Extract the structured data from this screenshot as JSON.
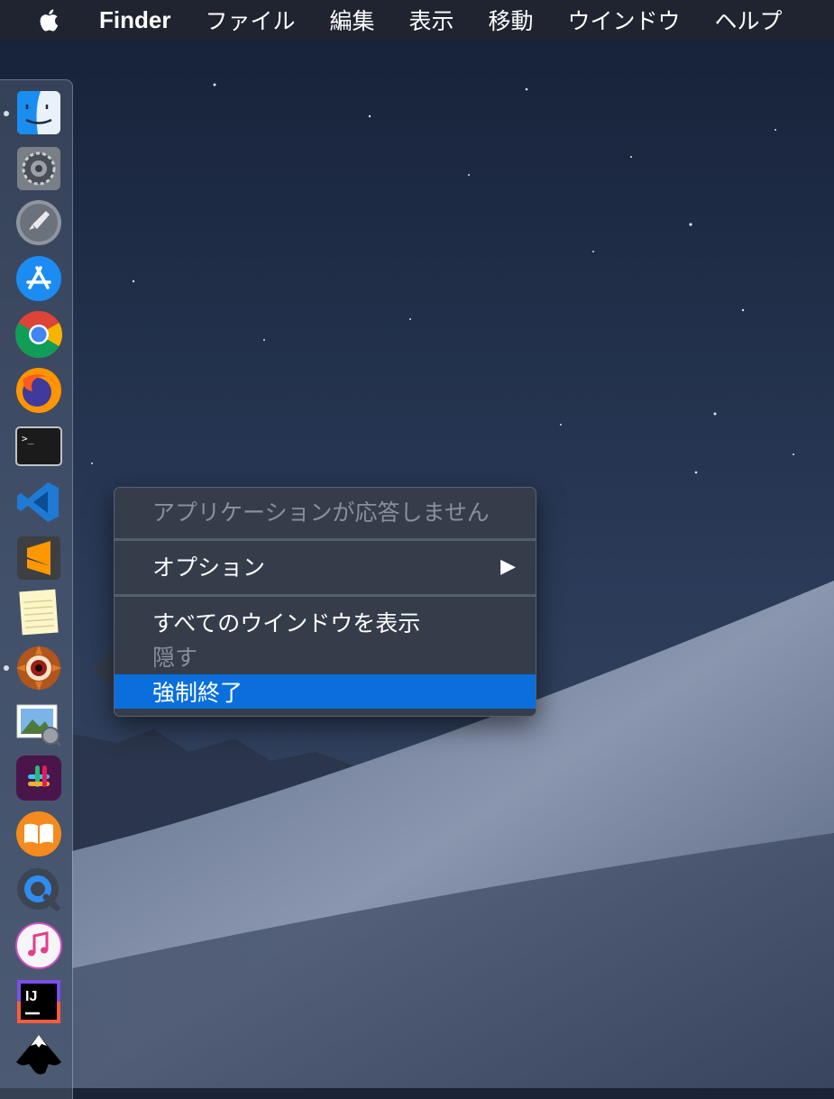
{
  "menubar": {
    "app_name": "Finder",
    "items": [
      "ファイル",
      "編集",
      "表示",
      "移動",
      "ウインドウ",
      "ヘルプ"
    ]
  },
  "dock": {
    "apps": [
      {
        "name": "finder-icon",
        "running": true
      },
      {
        "name": "system-preferences-icon",
        "running": false
      },
      {
        "name": "launchpad-icon",
        "running": false
      },
      {
        "name": "app-store-icon",
        "running": false
      },
      {
        "name": "chrome-icon",
        "running": false
      },
      {
        "name": "firefox-icon",
        "running": false
      },
      {
        "name": "terminal-icon",
        "running": false
      },
      {
        "name": "vscode-icon",
        "running": false
      },
      {
        "name": "sublime-text-icon",
        "running": false
      },
      {
        "name": "notes-icon",
        "running": false
      },
      {
        "name": "xnview-icon",
        "running": true
      },
      {
        "name": "preview-icon",
        "running": false
      },
      {
        "name": "slack-icon",
        "running": false
      },
      {
        "name": "ibooks-icon",
        "running": false
      },
      {
        "name": "quicktime-icon",
        "running": false
      },
      {
        "name": "itunes-icon",
        "running": false
      },
      {
        "name": "intellij-icon",
        "running": false
      },
      {
        "name": "inkscape-icon",
        "running": false
      }
    ],
    "terminal_prompt": ">_",
    "intellij_label": "IJ"
  },
  "context_menu": {
    "status": "アプリケーションが応答しません",
    "options": "オプション",
    "show_all_windows": "すべてのウインドウを表示",
    "hide": "隠す",
    "force_quit": "強制終了",
    "submenu_arrow": "▶"
  },
  "colors": {
    "highlight": "#0a6fdd",
    "menu_bg": "#353d4b"
  }
}
